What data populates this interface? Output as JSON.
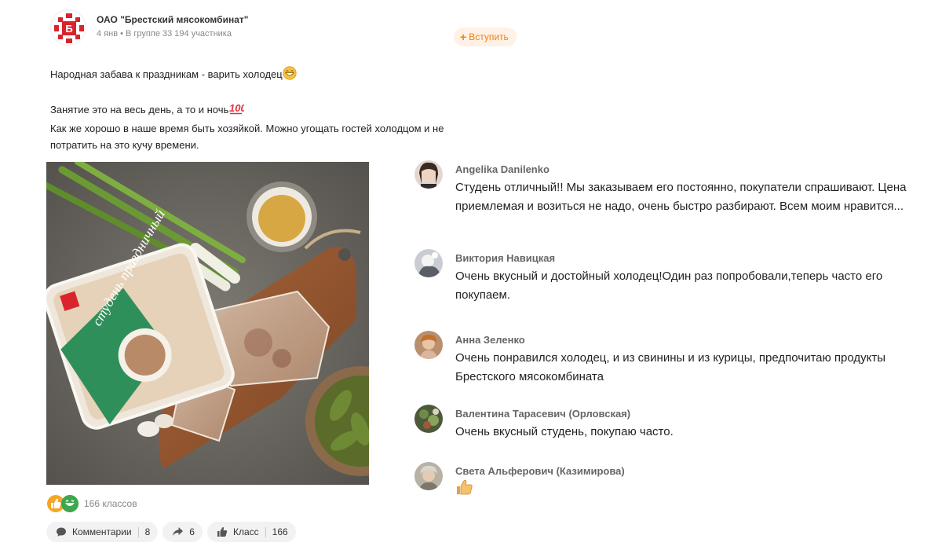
{
  "header": {
    "group_name": "ОАО \"Брестский мясокомбинат\"",
    "meta": "4 янв • В группе 33 194 участника",
    "join_label": "Вступить",
    "logo_letter": "Б"
  },
  "post": {
    "lines": [
      "Народная забава к праздникам - варить холодец",
      "Занятие это на весь день, а то и ночь",
      "Как же хорошо в наше время быть хозяйкой. Можно угощать гостей холодцом и не",
      "потратить на это кучу времени."
    ],
    "emoji": [
      "grinning-face-emoji",
      "hundred-points-emoji"
    ],
    "photo_label": "студень праздничный"
  },
  "comments": [
    {
      "author": "Angelika Danilenko",
      "text": "Студень отличный!! Мы заказываем его постоянно, покупатели спрашивают. Цена приемлемая и возиться не надо, очень быстро разбирают. Всем моим нравится..."
    },
    {
      "author": "Виктория Навицкая",
      "text": "Очень вкусный и достойный холодец!Один раз попробовали,теперь часто его покупаем."
    },
    {
      "author": "Анна Зеленко",
      "text": "Очень понравился холодец, и из свинины и из курицы, предпочитаю  продукты Брестского мясокомбината"
    },
    {
      "author": "Валентина Тарасевич (Орловская)",
      "text": "Очень вкусный студень, покупаю часто."
    },
    {
      "author": "Света Альферович (Казимирова)",
      "text": "",
      "sticker": "thumbs-up-emoji"
    }
  ],
  "reactions": {
    "klass_count": "166 классов"
  },
  "actions": {
    "comments_label": "Комментарии",
    "comments_count": "8",
    "share_count": "6",
    "klass_label": "Класс",
    "klass_count": "166"
  },
  "colors": {
    "accent": "#ee8208",
    "join_bg": "#fff1e6",
    "brand_red": "#d9232d",
    "action_bg": "#f2f2f2",
    "meta_text": "#888888"
  }
}
